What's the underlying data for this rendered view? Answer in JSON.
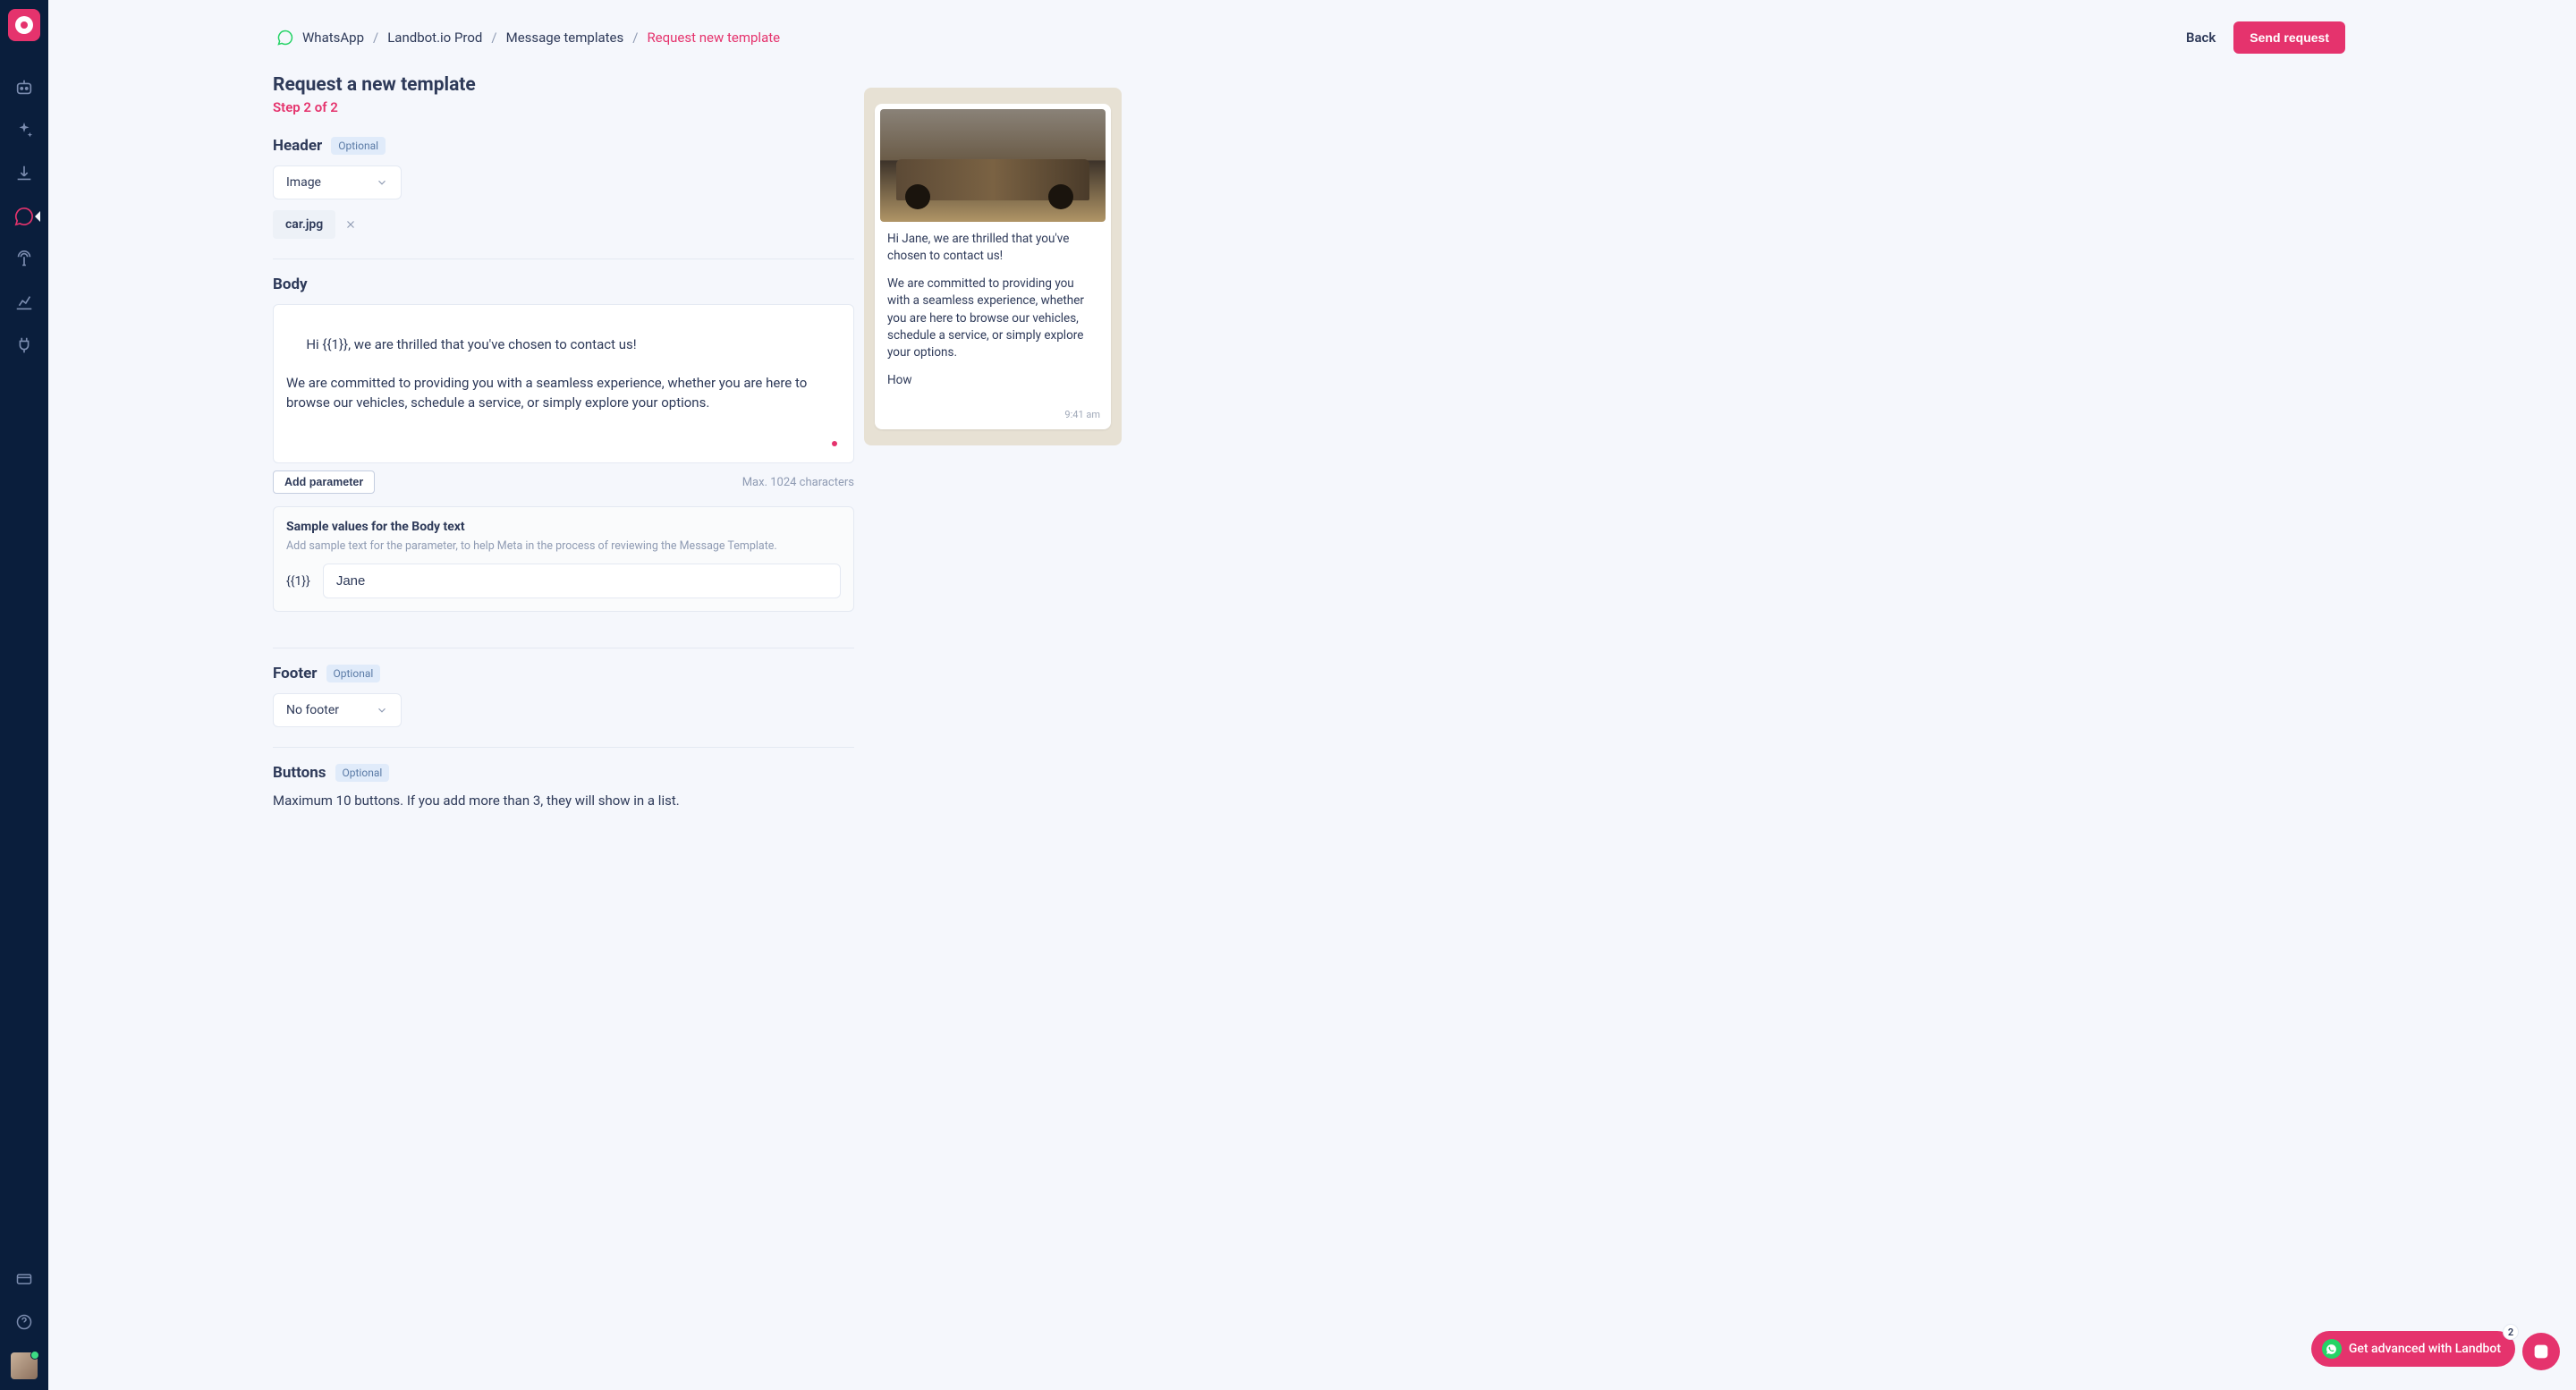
{
  "breadcrumb": {
    "items": [
      "WhatsApp",
      "Landbot.io Prod",
      "Message templates"
    ],
    "current": "Request new template"
  },
  "header": {
    "back": "Back",
    "send": "Send request"
  },
  "page": {
    "title": "Request a new template",
    "step": "Step 2 of 2"
  },
  "sections": {
    "header": {
      "title": "Header",
      "badge": "Optional",
      "select_value": "Image",
      "file_name": "car.jpg"
    },
    "body": {
      "title": "Body",
      "text": "Hi {{1}}, we are thrilled that you've chosen to contact us!\n\nWe are committed to providing you with a seamless experience, whether you are here to browse our vehicles, schedule a service, or simply explore your options.",
      "add_param": "Add parameter",
      "char_count": "Max. 1024 characters",
      "sample": {
        "title": "Sample values for the Body text",
        "desc": "Add sample text for the parameter, to help Meta in the process of reviewing the Message Template.",
        "param_label": "{{1}}",
        "value": "Jane"
      }
    },
    "footer": {
      "title": "Footer",
      "badge": "Optional",
      "select_value": "No footer"
    },
    "buttons": {
      "title": "Buttons",
      "badge": "Optional",
      "desc": "Maximum 10 buttons. If you add more than 3, they will show in a list."
    }
  },
  "preview": {
    "line1": "Hi Jane, we are thrilled that you've chosen to contact us!",
    "line2": "We are committed to providing you with a seamless experience, whether you are here to browse our vehicles, schedule a service, or simply explore your options.",
    "line3": "How",
    "time": "9:41 am"
  },
  "widgets": {
    "get_advanced": "Get advanced with Landbot",
    "badge_count": "2"
  }
}
